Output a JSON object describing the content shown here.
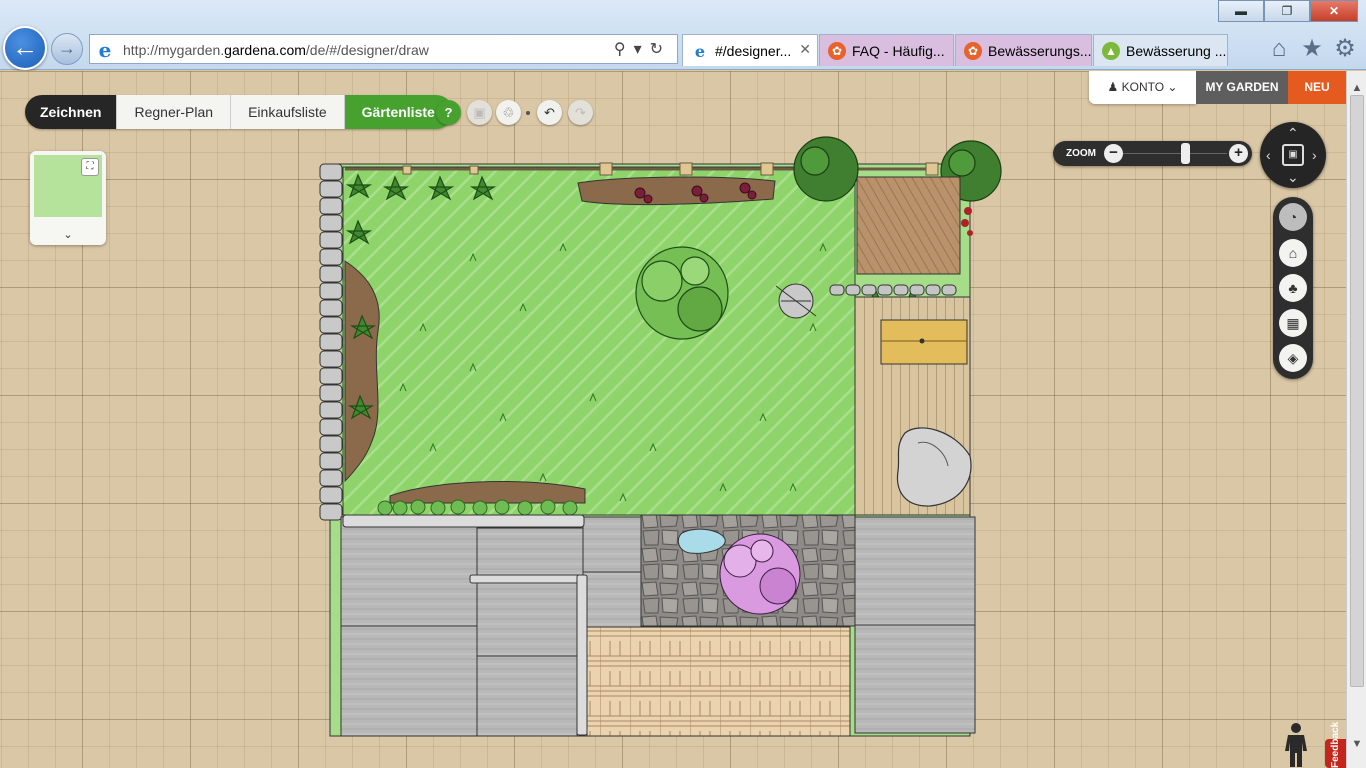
{
  "browser": {
    "url_prefix": "http://mygarden.",
    "url_domain": "gardena.com",
    "url_path": "/de/#/designer/draw",
    "tabs": [
      {
        "title": "#/designer...",
        "active": true
      },
      {
        "title": "FAQ - Häufig...",
        "active": false
      },
      {
        "title": "Bewässerungs...",
        "active": false
      },
      {
        "title": "Bewässerung ...",
        "active": false
      }
    ]
  },
  "app": {
    "modes": [
      "Zeichnen",
      "Regner-Plan",
      "Einkaufsliste",
      "Gärtenliste"
    ],
    "help_label": "?",
    "account": {
      "konto": "KONTO",
      "my_garden": "MY GARDEN",
      "new": "NEU"
    },
    "zoom_label": "ZOOM",
    "zoom_level": 0.6,
    "feedback_label": "Feedback"
  },
  "colors": {
    "lawn": "#8fd46b",
    "lawn_edge": "#5fa83e",
    "paving": "#b9b9b9",
    "deck": "#e9d2ad",
    "gravel_bed": "#b68a64",
    "accent_green": "#46a12e",
    "accent_orange": "#e55a1f"
  }
}
